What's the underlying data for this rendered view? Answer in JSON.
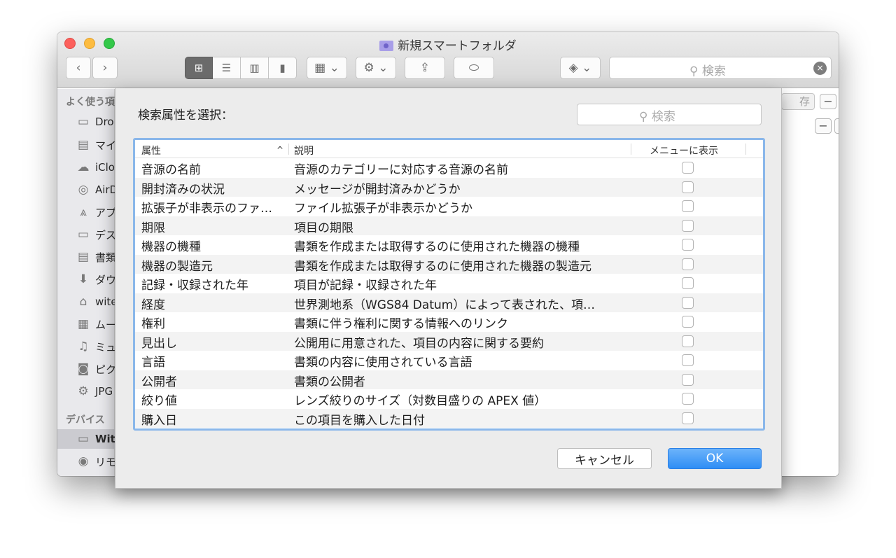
{
  "window": {
    "title": "新規スマートフォルダ",
    "toolbar": {
      "back_icon": "‹",
      "forward_icon": "›",
      "search_placeholder": "検索",
      "search_clear_icon": "×"
    }
  },
  "sidebar": {
    "favorites_header": "よく使う項",
    "devices_header": "デバイス",
    "items": [
      {
        "label": "Dro",
        "icon": "folder-icon"
      },
      {
        "label": "マイ",
        "icon": "document-stack-icon"
      },
      {
        "label": "iClo",
        "icon": "cloud-icon"
      },
      {
        "label": "AirD",
        "icon": "airdrop-icon"
      },
      {
        "label": "アプ",
        "icon": "applications-icon"
      },
      {
        "label": "デス",
        "icon": "desktop-icon"
      },
      {
        "label": "書類",
        "icon": "documents-icon"
      },
      {
        "label": "ダウ",
        "icon": "download-icon"
      },
      {
        "label": "wite",
        "icon": "home-icon"
      },
      {
        "label": "ムー",
        "icon": "movies-icon"
      },
      {
        "label": "ミュ",
        "icon": "music-icon"
      },
      {
        "label": "ピク",
        "icon": "camera-icon"
      },
      {
        "label": "JPG",
        "icon": "gear-icon"
      }
    ],
    "device_items": [
      {
        "label": "Wit",
        "icon": "laptop-icon"
      },
      {
        "label": "リモ",
        "icon": "disc-icon"
      }
    ]
  },
  "right_pane": {
    "save_label": "存",
    "minus_label": "−",
    "plus_label": "+"
  },
  "sheet": {
    "title": "検索属性を選択：",
    "search_placeholder": "検索",
    "columns": {
      "attribute": "属性",
      "description": "説明",
      "show_in_menu": "メニューに表示",
      "sort_indicator": "^"
    },
    "rows": [
      {
        "attribute": "音源の名前",
        "description": "音源のカテゴリーに対応する音源の名前",
        "checked": false
      },
      {
        "attribute": "開封済みの状況",
        "description": "メッセージが開封済みかどうか",
        "checked": false
      },
      {
        "attribute": "拡張子が非表示のファ…",
        "description": "ファイル拡張子が非表示かどうか",
        "checked": false
      },
      {
        "attribute": "期限",
        "description": "項目の期限",
        "checked": false
      },
      {
        "attribute": "機器の機種",
        "description": "書類を作成または取得するのに使用された機器の機種",
        "checked": false
      },
      {
        "attribute": "機器の製造元",
        "description": "書類を作成または取得するのに使用された機器の製造元",
        "checked": false
      },
      {
        "attribute": "記録・収録された年",
        "description": "項目が記録・収録された年",
        "checked": false
      },
      {
        "attribute": "経度",
        "description": "世界測地系（WGS84 Datum）によって表された、項…",
        "checked": false
      },
      {
        "attribute": "権利",
        "description": "書類に伴う権利に関する情報へのリンク",
        "checked": false
      },
      {
        "attribute": "見出し",
        "description": "公開用に用意された、項目の内容に関する要約",
        "checked": false
      },
      {
        "attribute": "言語",
        "description": "書類の内容に使用されている言語",
        "checked": false
      },
      {
        "attribute": "公開者",
        "description": "書類の公開者",
        "checked": false
      },
      {
        "attribute": "絞り値",
        "description": "レンズ絞りのサイズ（対数目盛りの APEX 値）",
        "checked": false
      },
      {
        "attribute": "購入日",
        "description": "この項目を購入した日付",
        "checked": false
      }
    ],
    "cancel_label": "キャンセル",
    "ok_label": "OK"
  }
}
